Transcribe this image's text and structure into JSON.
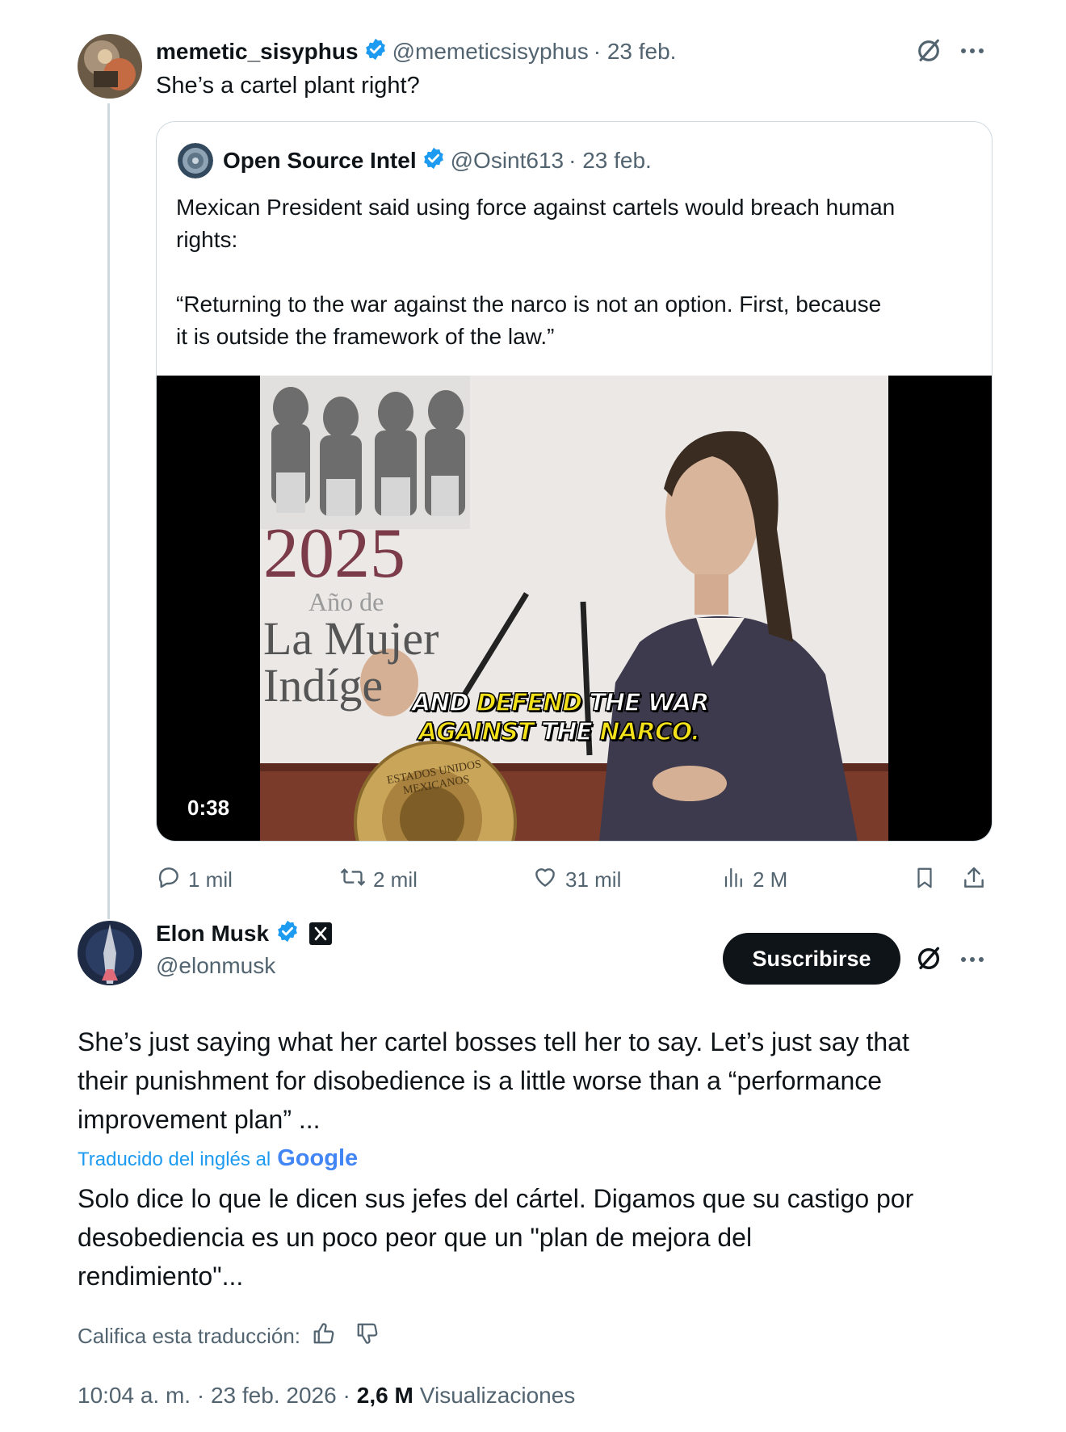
{
  "tweet1": {
    "display_name": "memetic_sisyphus",
    "handle": "@memeticsisyphus",
    "date": "· 23 feb.",
    "text": "She’s a cartel plant right?"
  },
  "quote": {
    "display_name": "Open Source Intel",
    "handle": "@Osint613",
    "date": "· 23 feb.",
    "text_line1": "Mexican President said using force against cartels would breach human",
    "text_line2": "rights:",
    "quote_line1": "“Returning to the war against the narco is not an option. First, because",
    "quote_line2": "it is outside the framework of the law.”",
    "video": {
      "duration": "0:38",
      "backdrop_year": "2025",
      "backdrop_line1": "Año de",
      "backdrop_line2": "La Mujer",
      "backdrop_line3": "Indíge",
      "seal_text": "ESTADOS UNIDOS MEXICANOS",
      "subtitle_line1_a": "AND",
      "subtitle_line1_b": "DEFEND",
      "subtitle_line1_c": "THE WAR",
      "subtitle_line2_a": "AGAINST",
      "subtitle_line2_b": "THE",
      "subtitle_line2_c": "NARCO."
    }
  },
  "actions": {
    "replies": "1 mil",
    "reposts": "2 mil",
    "likes": "31 mil",
    "views": "2 M"
  },
  "tweet2": {
    "display_name": "Elon Musk",
    "handle": "@elonmusk",
    "subscribe_label": "Suscribirse",
    "text_line1": "She’s just saying what her cartel bosses tell her to say. Let’s just say that",
    "text_line2": "their punishment for disobedience is a little worse than a “performance",
    "text_line3": "improvement plan” ...",
    "translated_label": "Traducido del inglés al",
    "google_label": "Google",
    "translation_line1": "Solo dice lo que le dicen sus jefes del cártel. Digamos que su castigo por",
    "translation_line2": "desobediencia es un poco peor que un \"plan de mejora del",
    "translation_line3": "rendimiento\"...",
    "rate_label": "Califica esta traducción:",
    "timestamp": "10:04 a. m. · 23 feb. 2026 ·",
    "views_count": "2,6 M",
    "views_label": "Visualizaciones"
  },
  "colors": {
    "text": "#0f1419",
    "muted": "#536471",
    "verified": "#1d9bf0",
    "border": "#cfd9de",
    "link": "#1d9bf0"
  },
  "icons": [
    "grok-icon",
    "more-icon",
    "verified-badge-icon",
    "reply-icon",
    "repost-icon",
    "like-icon",
    "views-icon",
    "bookmark-icon",
    "share-icon",
    "x-affiliate-icon",
    "thumb-up-icon",
    "thumb-down-icon"
  ]
}
